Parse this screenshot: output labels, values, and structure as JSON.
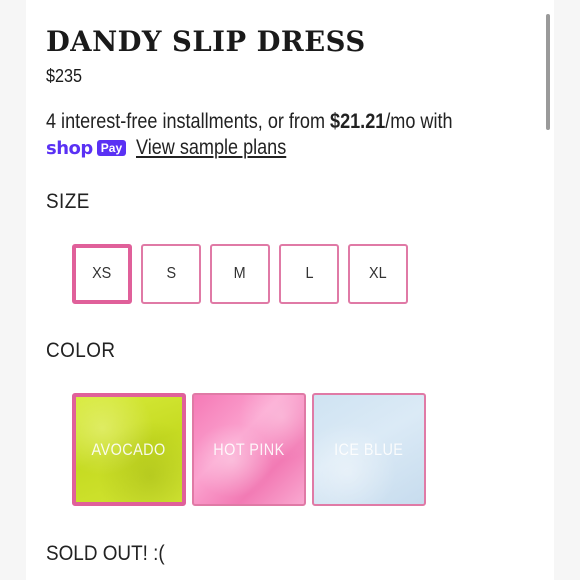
{
  "product": {
    "title": "DANDY SLIP DRESS",
    "price": "$235"
  },
  "installments": {
    "text_before": "4 interest-free installments, or from ",
    "amount": "$21.21",
    "text_after": "/mo with",
    "shop_logo": "shop",
    "pay_badge": "Pay",
    "sample_link": "View sample plans"
  },
  "size": {
    "label": "SIZE",
    "options": [
      "XS",
      "S",
      "M",
      "L",
      "XL"
    ],
    "selected": "XS"
  },
  "color": {
    "label": "COLOR",
    "options": [
      "AVOCADO",
      "HOT PINK",
      "ICE BLUE"
    ],
    "selected": "AVOCADO"
  },
  "status": {
    "sold_out": "SOLD OUT! :("
  },
  "colors": {
    "accent_border": "#e0609a",
    "shop_pay": "#5a31f4",
    "avocado": "#d2e533",
    "hot_pink": "#f57ab6",
    "ice_blue": "#cfe3f2"
  }
}
